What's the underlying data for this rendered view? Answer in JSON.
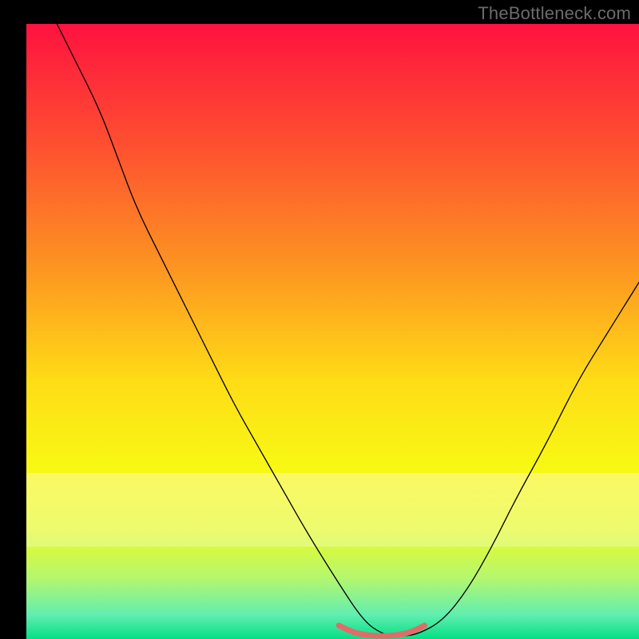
{
  "watermark": "TheBottleneck.com",
  "chart_data": {
    "type": "line",
    "title": "",
    "xlabel": "",
    "ylabel": "",
    "xlim": [
      0,
      100
    ],
    "ylim": [
      0,
      100
    ],
    "background_gradient": {
      "stops": [
        {
          "offset": 0.0,
          "color": "#fe123f"
        },
        {
          "offset": 0.2,
          "color": "#fe5130"
        },
        {
          "offset": 0.4,
          "color": "#fd9621"
        },
        {
          "offset": 0.58,
          "color": "#fedc16"
        },
        {
          "offset": 0.72,
          "color": "#f8f814"
        },
        {
          "offset": 0.82,
          "color": "#ecfb25"
        },
        {
          "offset": 0.9,
          "color": "#b5f76d"
        },
        {
          "offset": 0.96,
          "color": "#62eeb0"
        },
        {
          "offset": 1.0,
          "color": "#04e085"
        }
      ]
    },
    "highlight_band": {
      "y_from": 73,
      "y_to": 85,
      "color_stops": [
        {
          "offset": 0.0,
          "color": "#fef9a0"
        },
        {
          "offset": 0.45,
          "color": "#f6faa5"
        },
        {
          "offset": 1.0,
          "color": "#e9fbaa"
        }
      ],
      "opacity": 0.55
    },
    "series": [
      {
        "name": "curve",
        "color": "#000000",
        "width": 1.3,
        "x": [
          5,
          8,
          12,
          15,
          18,
          22,
          26,
          30,
          34,
          38,
          42,
          46,
          51,
          55,
          58,
          61,
          64,
          68,
          72,
          76,
          80,
          85,
          90,
          95,
          100
        ],
        "y": [
          100,
          94,
          86,
          78,
          70,
          62,
          54,
          46,
          38,
          31,
          24,
          17,
          9,
          3,
          0.8,
          0.4,
          0.8,
          3,
          8,
          15,
          23,
          32,
          42,
          50,
          58
        ]
      }
    ],
    "flat_marker": {
      "color": "#e46a6a",
      "width": 7,
      "x": [
        51,
        53,
        55,
        57,
        59,
        61,
        63,
        65
      ],
      "y": [
        2.2,
        1.2,
        0.7,
        0.5,
        0.5,
        0.7,
        1.2,
        2.2
      ]
    }
  }
}
